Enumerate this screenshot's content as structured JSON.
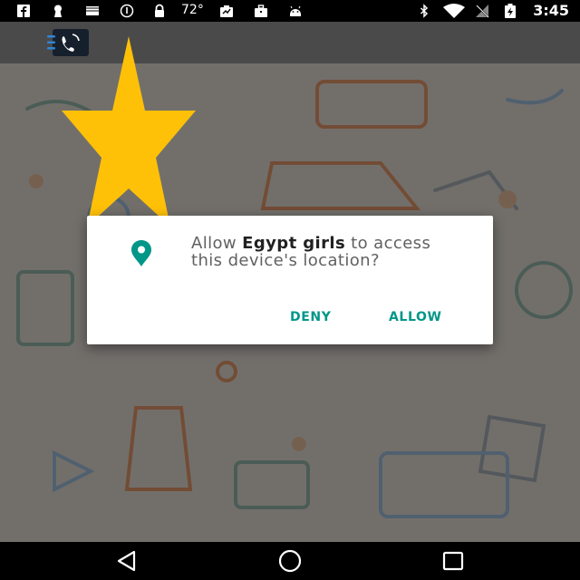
{
  "status_bar": {
    "temperature": "72°",
    "time": "3:45",
    "icons": [
      "facebook-icon",
      "keyhole-icon",
      "mail-icon",
      "info-icon",
      "lock-icon",
      "weather-icon",
      "work-icon",
      "android-icon",
      "bluetooth-icon",
      "wifi-icon",
      "no-signal-icon",
      "battery-charging-icon"
    ]
  },
  "app_bar": {
    "logo_icon": "phone-call-icon"
  },
  "dialog": {
    "icon": "location-pin-icon",
    "message_prefix": "Allow ",
    "app_name": "Egypt girls",
    "message_suffix": " to access this device's location?",
    "deny_label": "DENY",
    "allow_label": "ALLOW"
  },
  "nav_bar": {
    "buttons": [
      "back-icon",
      "home-icon",
      "recents-icon"
    ]
  },
  "colors": {
    "accent": "#009688",
    "star": "#FFC107",
    "status_bar": "#000000",
    "dialog_bg": "#FFFFFF"
  }
}
